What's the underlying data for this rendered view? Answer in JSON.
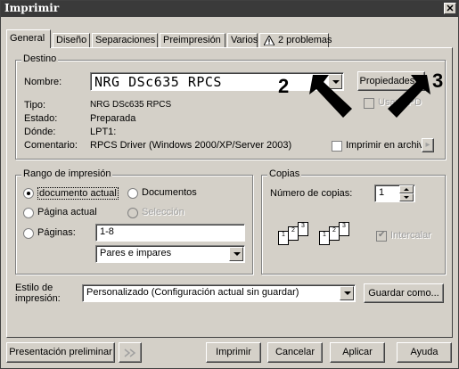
{
  "title": "Imprimir",
  "close_glyph": "✕",
  "tabs": [
    "General",
    "Diseño",
    "Separaciones",
    "Preimpresión",
    "Varios",
    "2 problemas"
  ],
  "destino": {
    "legend": "Destino",
    "nombre_label": "Nombre:",
    "nombre_value": "NRG DSc635 RPCS",
    "propiedades_label": "Propiedades...",
    "usar_ppd_label": "Usar PPD",
    "tipo_label": "Tipo:",
    "tipo_value": "NRG DSc635 RPCS",
    "estado_label": "Estado:",
    "estado_value": "Preparada",
    "donde_label": "Dónde:",
    "donde_value": "LPT1:",
    "comentario_label": "Comentario:",
    "comentario_value": "RPCS Driver (Windows 2000/XP/Server 2003)",
    "imprimir_archivo_label": "Imprimir en archivo",
    "arrow_glyph": "▸"
  },
  "annotations": {
    "num2": "2",
    "num3": "3"
  },
  "rango": {
    "legend": "Rango de impresión",
    "documento_actual": "documento actual",
    "documentos": "Documentos",
    "pagina_actual": "Página actual",
    "seleccion": "Selección",
    "paginas": "Páginas:",
    "paginas_value": "1-8",
    "pares_impares": "Pares e impares"
  },
  "copias": {
    "legend": "Copias",
    "numero_label": "Número de copias:",
    "numero_value": "1",
    "intercalar_label": "Intercalar",
    "page_numbers": [
      "1",
      "2",
      "3"
    ]
  },
  "estilo": {
    "label_line1": "Estilo de",
    "label_line2": "impresión:",
    "value": "Personalizado (Configuración actual sin guardar)",
    "guardar_label": "Guardar como..."
  },
  "bottom": {
    "presentacion": "Presentación preliminar",
    "imprimir": "Imprimir",
    "cancelar": "Cancelar",
    "aplicar": "Aplicar",
    "ayuda": "Ayuda"
  }
}
